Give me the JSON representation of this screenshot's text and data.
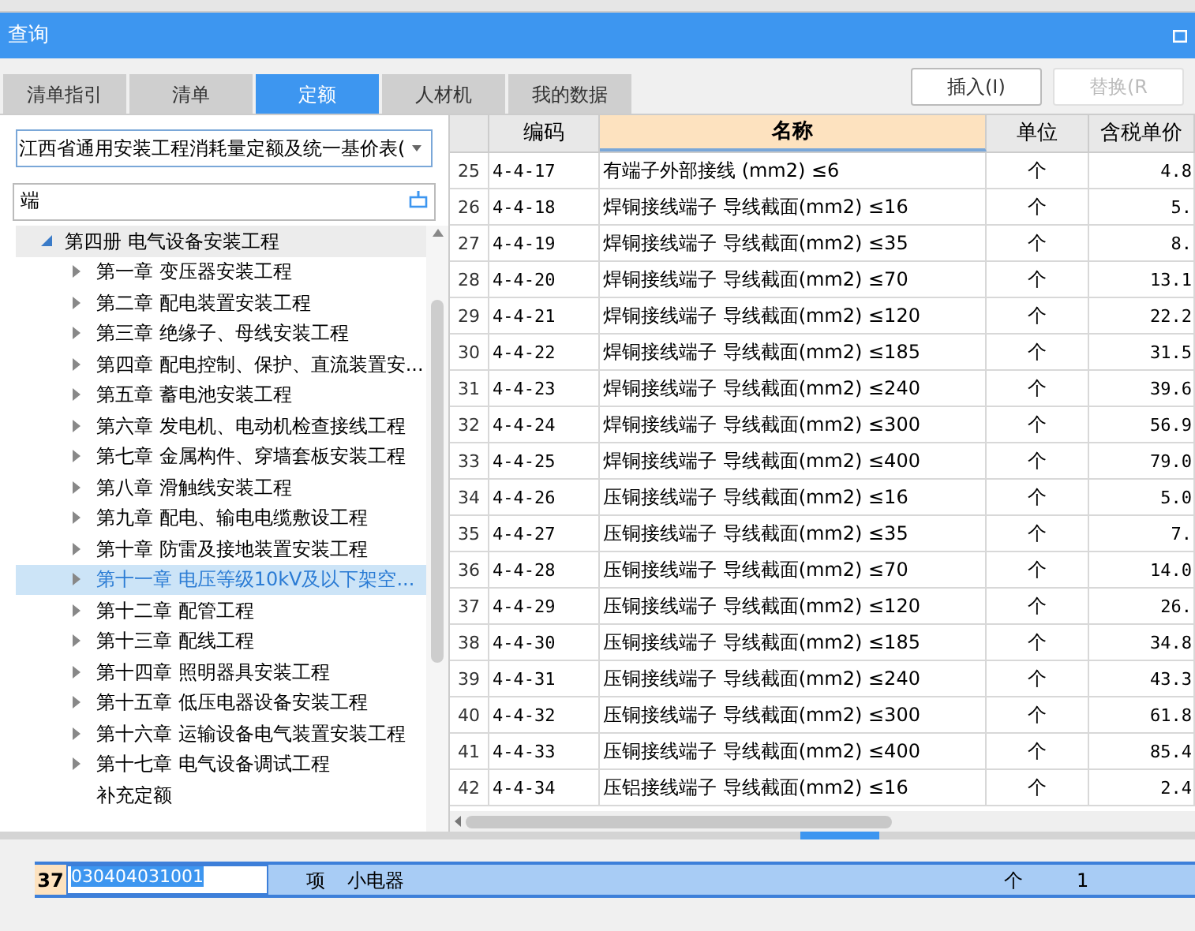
{
  "window": {
    "title": "查询"
  },
  "tabs": [
    {
      "label": "清单指引",
      "selected": false
    },
    {
      "label": "清单",
      "selected": false
    },
    {
      "label": "定额",
      "selected": true
    },
    {
      "label": "人材机",
      "selected": false
    },
    {
      "label": "我的数据",
      "selected": false
    }
  ],
  "actions": [
    {
      "label": "插入(I)",
      "disabled": false
    },
    {
      "label": "替换(R",
      "disabled": true
    }
  ],
  "library_select": {
    "value": "江西省通用安装工程消耗量定额及统一基价表("
  },
  "search": {
    "value": "端"
  },
  "tree": [
    {
      "label": "第四册 电气设备安装工程",
      "kind": "branch",
      "expanded": true,
      "selected": false,
      "children": [
        {
          "label": "第一章 变压器安装工程",
          "kind": "branch",
          "expanded": false,
          "selected": false
        },
        {
          "label": "第二章 配电装置安装工程",
          "kind": "branch",
          "expanded": false,
          "selected": false
        },
        {
          "label": "第三章 绝缘子、母线安装工程",
          "kind": "branch",
          "expanded": false,
          "selected": false
        },
        {
          "label": "第四章 配电控制、保护、直流装置安...",
          "kind": "branch",
          "expanded": false,
          "selected": false
        },
        {
          "label": "第五章 蓄电池安装工程",
          "kind": "branch",
          "expanded": false,
          "selected": false
        },
        {
          "label": "第六章 发电机、电动机检查接线工程",
          "kind": "branch",
          "expanded": false,
          "selected": false
        },
        {
          "label": "第七章 金属构件、穿墙套板安装工程",
          "kind": "branch",
          "expanded": false,
          "selected": false
        },
        {
          "label": "第八章 滑触线安装工程",
          "kind": "branch",
          "expanded": false,
          "selected": false
        },
        {
          "label": "第九章 配电、输电电缆敷设工程",
          "kind": "branch",
          "expanded": false,
          "selected": false
        },
        {
          "label": "第十章 防雷及接地装置安装工程",
          "kind": "branch",
          "expanded": false,
          "selected": false
        },
        {
          "label": "第十一章 电压等级10kV及以下架空...",
          "kind": "branch",
          "expanded": false,
          "selected": true
        },
        {
          "label": "第十二章 配管工程",
          "kind": "branch",
          "expanded": false,
          "selected": false
        },
        {
          "label": "第十三章 配线工程",
          "kind": "branch",
          "expanded": false,
          "selected": false
        },
        {
          "label": "第十四章 照明器具安装工程",
          "kind": "branch",
          "expanded": false,
          "selected": false
        },
        {
          "label": "第十五章 低压电器设备安装工程",
          "kind": "branch",
          "expanded": false,
          "selected": false
        },
        {
          "label": "第十六章 运输设备电气装置安装工程",
          "kind": "branch",
          "expanded": false,
          "selected": false
        },
        {
          "label": "第十七章 电气设备调试工程",
          "kind": "branch",
          "expanded": false,
          "selected": false
        },
        {
          "label": "补充定额",
          "kind": "leaf",
          "selected": false
        }
      ]
    }
  ],
  "table": {
    "columns": [
      {
        "selected": false
      },
      {
        "label": "编码",
        "selected": false
      },
      {
        "label": "名称",
        "selected": true
      },
      {
        "label": "单位",
        "selected": false
      },
      {
        "label": "含税单价",
        "selected": false
      }
    ],
    "rows": [
      [
        "25",
        "4-4-17",
        "有端子外部接线 (mm2) ≤6",
        "个",
        "4.8"
      ],
      [
        "26",
        "4-4-18",
        "焊铜接线端子 导线截面(mm2) ≤16",
        "个",
        "5."
      ],
      [
        "27",
        "4-4-19",
        "焊铜接线端子 导线截面(mm2) ≤35",
        "个",
        "8."
      ],
      [
        "28",
        "4-4-20",
        "焊铜接线端子 导线截面(mm2) ≤70",
        "个",
        "13.1"
      ],
      [
        "29",
        "4-4-21",
        "焊铜接线端子 导线截面(mm2) ≤120",
        "个",
        "22.2"
      ],
      [
        "30",
        "4-4-22",
        "焊铜接线端子 导线截面(mm2) ≤185",
        "个",
        "31.5"
      ],
      [
        "31",
        "4-4-23",
        "焊铜接线端子 导线截面(mm2) ≤240",
        "个",
        "39.6"
      ],
      [
        "32",
        "4-4-24",
        "焊铜接线端子 导线截面(mm2) ≤300",
        "个",
        "56.9"
      ],
      [
        "33",
        "4-4-25",
        "焊铜接线端子 导线截面(mm2) ≤400",
        "个",
        "79.0"
      ],
      [
        "34",
        "4-4-26",
        "压铜接线端子 导线截面(mm2) ≤16",
        "个",
        "5.0"
      ],
      [
        "35",
        "4-4-27",
        "压铜接线端子 导线截面(mm2) ≤35",
        "个",
        "7."
      ],
      [
        "36",
        "4-4-28",
        "压铜接线端子 导线截面(mm2) ≤70",
        "个",
        "14.0"
      ],
      [
        "37",
        "4-4-29",
        "压铜接线端子 导线截面(mm2) ≤120",
        "个",
        "26."
      ],
      [
        "38",
        "4-4-30",
        "压铜接线端子 导线截面(mm2) ≤185",
        "个",
        "34.8"
      ],
      [
        "39",
        "4-4-31",
        "压铜接线端子 导线截面(mm2) ≤240",
        "个",
        "43.3"
      ],
      [
        "40",
        "4-4-32",
        "压铜接线端子 导线截面(mm2) ≤300",
        "个",
        "61.8"
      ],
      [
        "41",
        "4-4-33",
        "压铜接线端子 导线截面(mm2) ≤400",
        "个",
        "85.4"
      ],
      [
        "42",
        "4-4-34",
        "压铝接线端子 导线截面(mm2) ≤16",
        "个",
        "2.4"
      ]
    ]
  },
  "bill_row": {
    "number": "37",
    "code": "030404031001",
    "type": "项",
    "name": "小电器",
    "unit": "个",
    "quantity": "1"
  }
}
